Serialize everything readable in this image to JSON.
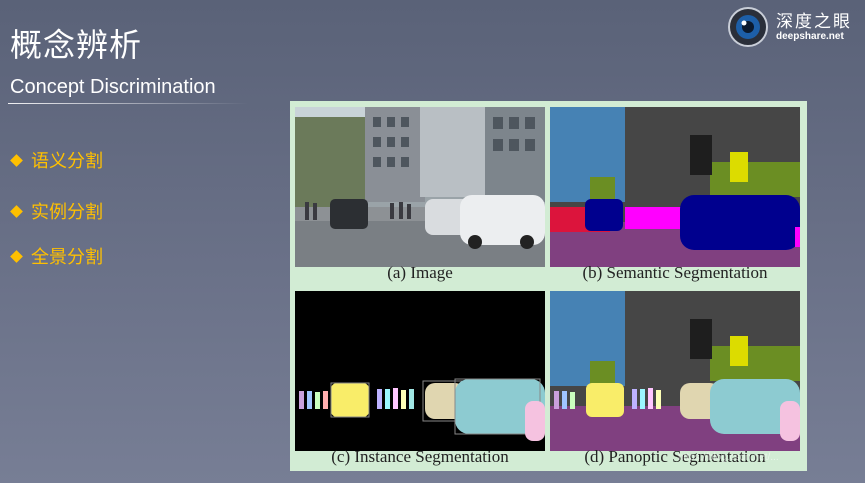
{
  "slide": {
    "title": "概念辨析",
    "subtitle": "Concept Discrimination"
  },
  "logo": {
    "name_cn": "深度之眼",
    "domain": "deepshare.net",
    "icon": "eye-logo-icon"
  },
  "bullets": [
    {
      "label": "语义分割"
    },
    {
      "label": "实例分割"
    },
    {
      "label": "全景分割"
    }
  ],
  "figure": {
    "panels": [
      {
        "caption": "(a) Image"
      },
      {
        "caption": "(b) Semantic Segmentation"
      },
      {
        "caption": "(c) Instance Segmentation"
      },
      {
        "caption": "(d) Panoptic Segmentation"
      }
    ]
  },
  "watermark": "https://blog.csdn.net/..."
}
